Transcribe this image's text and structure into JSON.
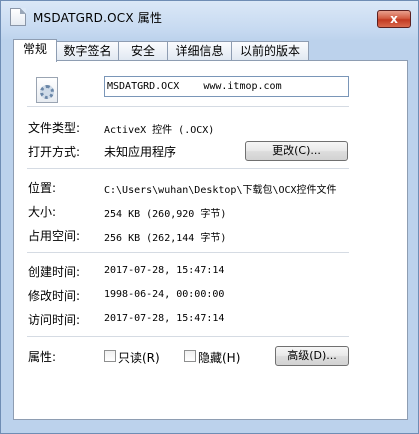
{
  "window": {
    "title": "MSDATGRD.OCX 属性",
    "close_label": "x"
  },
  "tabs": [
    {
      "label": "常规",
      "active": true
    },
    {
      "label": "数字签名",
      "active": false
    },
    {
      "label": "安全",
      "active": false
    },
    {
      "label": "详细信息",
      "active": false
    },
    {
      "label": "以前的版本",
      "active": false
    }
  ],
  "general": {
    "filename": "MSDATGRD.OCX    www.itmop.com",
    "file_type_label": "文件类型:",
    "file_type_value": "ActiveX 控件 (.OCX)",
    "open_with_label": "打开方式:",
    "open_with_value": "未知应用程序",
    "change_button": "更改(C)...",
    "location_label": "位置:",
    "location_value": "C:\\Users\\wuhan\\Desktop\\下载包\\OCX控件文件",
    "size_label": "大小:",
    "size_value": "254 KB (260,920 字节)",
    "size_on_disk_label": "占用空间:",
    "size_on_disk_value": "256 KB (262,144 字节)",
    "created_label": "创建时间:",
    "created_value": "2017-07-28, 15:47:14",
    "modified_label": "修改时间:",
    "modified_value": "1998-06-24, 00:00:00",
    "accessed_label": "访问时间:",
    "accessed_value": "2017-07-28, 15:47:14",
    "attributes_label": "属性:",
    "readonly_label": "只读(R)",
    "readonly_checked": false,
    "hidden_label": "隐藏(H)",
    "hidden_checked": false,
    "advanced_button": "高级(D)..."
  },
  "icons": {
    "title_icon": "file-icon",
    "file_icon": "activex-gear-file-icon"
  }
}
